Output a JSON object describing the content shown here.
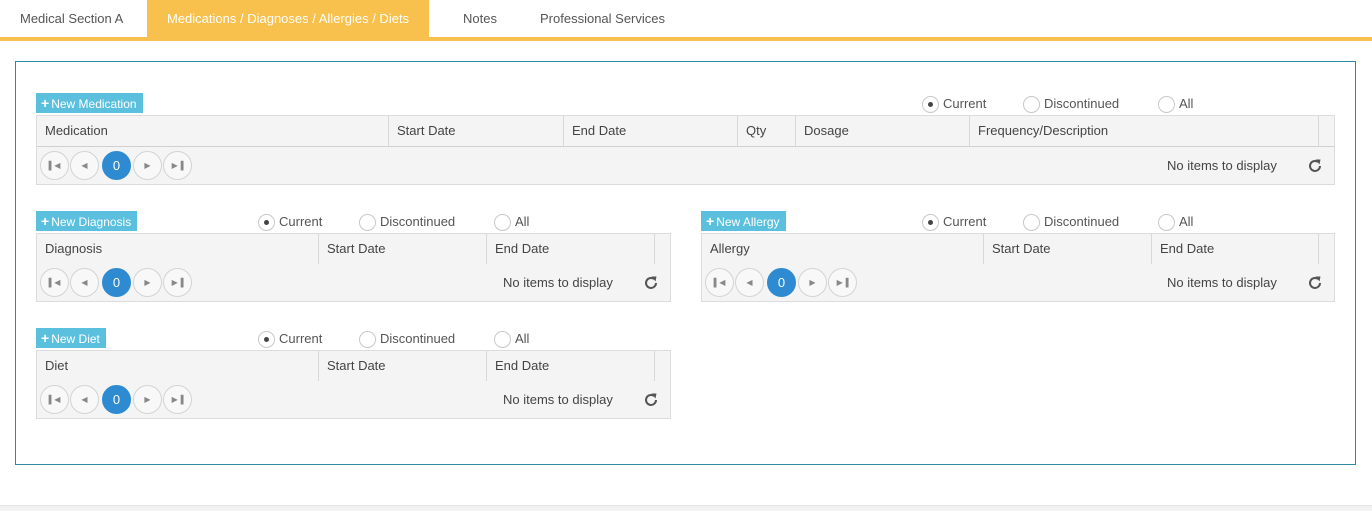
{
  "tabs": [
    {
      "label": "Medical Section A",
      "active": false
    },
    {
      "label": "Medications / Diagnoses / Allergies / Diets",
      "active": true
    },
    {
      "label": "Notes",
      "active": false
    },
    {
      "label": "Professional Services",
      "active": false
    }
  ],
  "filters": {
    "current": "Current",
    "discontinued": "Discontinued",
    "all": "All"
  },
  "pager": {
    "page": "0",
    "empty_text": "No items to display"
  },
  "medication": {
    "new_label": "New Medication",
    "columns": [
      "Medication",
      "Start Date",
      "End Date",
      "Qty",
      "Dosage",
      "Frequency/Description"
    ]
  },
  "diagnosis": {
    "new_label": "New Diagnosis",
    "columns": [
      "Diagnosis",
      "Start Date",
      "End Date"
    ]
  },
  "allergy": {
    "new_label": "New Allergy",
    "columns": [
      "Allergy",
      "Start Date",
      "End Date"
    ]
  },
  "diet": {
    "new_label": "New Diet",
    "columns": [
      "Diet",
      "Start Date",
      "End Date"
    ]
  },
  "colors": {
    "accent_tab": "#f8c04c",
    "button": "#5bc0de",
    "page_active": "#2e8bd1",
    "panel_border": "#2a8aa0"
  }
}
